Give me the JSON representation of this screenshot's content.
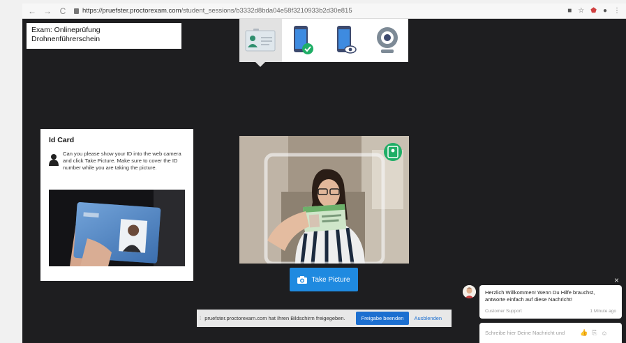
{
  "browser": {
    "back": "←",
    "forward": "→",
    "reload": "C",
    "url_host": "https://pruefster.proctorexam.com",
    "url_path": "/student_sessions/b3332d8bda04e58f3210933b2d30e815"
  },
  "exam": {
    "line1": "Exam: Onlineprüfung",
    "line2": "Drohnenführerschein"
  },
  "steps": [
    {
      "icon": "id-card-icon",
      "active": true
    },
    {
      "icon": "phone-check-icon",
      "active": false
    },
    {
      "icon": "phone-eye-icon",
      "active": false
    },
    {
      "icon": "webcam-icon",
      "active": false
    }
  ],
  "id_card": {
    "title": "Id Card",
    "instructions": "Can you please show your ID into the web camera and click Take Picture. Make sure to cover the ID number while you are taking the picture."
  },
  "camera": {
    "take_picture_label": "Take Picture"
  },
  "share_bar": {
    "message": "pruefster.proctorexam.com hat Ihren Bildschirm freigegeben.",
    "stop_label": "Freigabe beenden",
    "hide_label": "Ausblenden"
  },
  "chat": {
    "close": "×",
    "message": "Herzlich Willkommen! Wenn Du Hilfe brauchst, antworte einfach auf diese Nachricht!",
    "sender": "Customer Support",
    "time": "1 Minute ago",
    "input_placeholder": "Schreibe hier Deine Nachricht und"
  },
  "colors": {
    "stage_bg": "#1e1e20",
    "accent": "#1f8ae0",
    "share_button": "#1c6fd0",
    "check_green": "#1fae66"
  }
}
